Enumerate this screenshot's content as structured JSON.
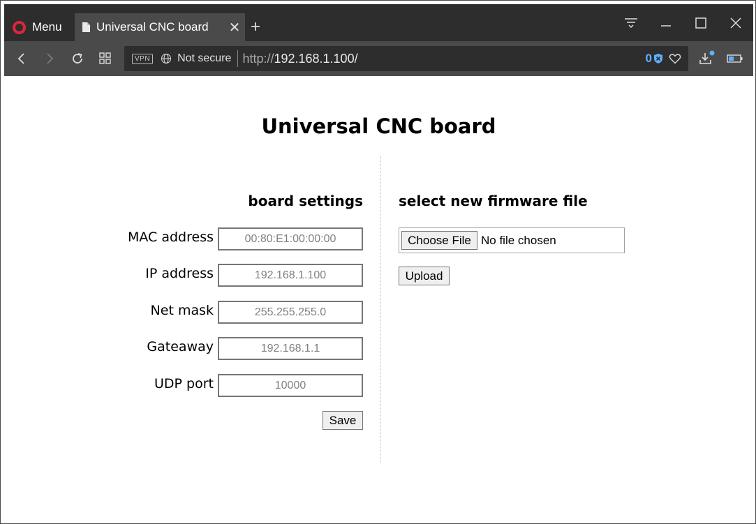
{
  "browser": {
    "menu_label": "Menu",
    "tab_title": "Universal CNC board",
    "new_tab_label": "+",
    "vpn_label": "VPN",
    "security_label": "Not secure",
    "url_scheme": "http://",
    "url_host": "192.168.1.100/",
    "blocked_count": "0",
    "accent_color": "#e0253a",
    "blocker_color": "#5fb0ff"
  },
  "page": {
    "title": "Universal CNC board",
    "board_settings": {
      "heading": "board settings",
      "fields": [
        {
          "label": "MAC address",
          "placeholder": "00:80:E1:00:00:00"
        },
        {
          "label": "IP address",
          "placeholder": "192.168.1.100"
        },
        {
          "label": "Net mask",
          "placeholder": "255.255.255.0"
        },
        {
          "label": "Gateaway",
          "placeholder": "192.168.1.1"
        },
        {
          "label": "UDP port",
          "placeholder": "10000"
        }
      ],
      "save_label": "Save"
    },
    "firmware": {
      "heading": "select new firmware file",
      "choose_label": "Choose File",
      "file_status": "No file chosen",
      "upload_label": "Upload"
    }
  }
}
